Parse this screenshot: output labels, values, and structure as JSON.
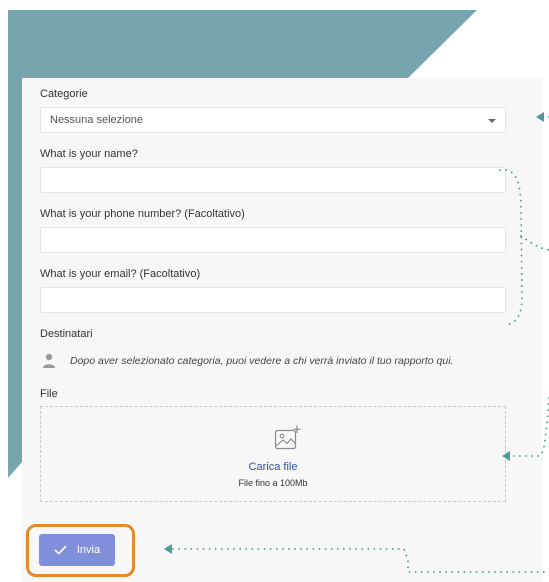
{
  "form": {
    "category": {
      "label": "Categorie",
      "value": "Nessuna selezione"
    },
    "name": {
      "label": "What is your name?",
      "value": ""
    },
    "phone": {
      "label": "What is your phone number? (Facoltativo)",
      "value": ""
    },
    "email": {
      "label": "What is your email? (Facoltativo)",
      "value": ""
    },
    "recipients": {
      "label": "Destinatari",
      "message": "Dopo aver selezionato categoria, puoi vedere a chi verrà inviato il tuo rapporto qui."
    },
    "file": {
      "label": "File",
      "upload_label": "Carica file",
      "hint": "File fino a 100Mb"
    },
    "submit_label": "Invia"
  },
  "colors": {
    "background_shape": "#77a5ae",
    "panel": "#f7f7f7",
    "submit_button": "#7f8fd9",
    "highlight": "#e48a2a",
    "annotation": "#4f9a94",
    "link": "#2f4fa0"
  },
  "icons": {
    "category_arrow": "arrow-left-icon",
    "recipient": "person-icon",
    "upload": "image-add-icon",
    "submit": "check-icon"
  }
}
